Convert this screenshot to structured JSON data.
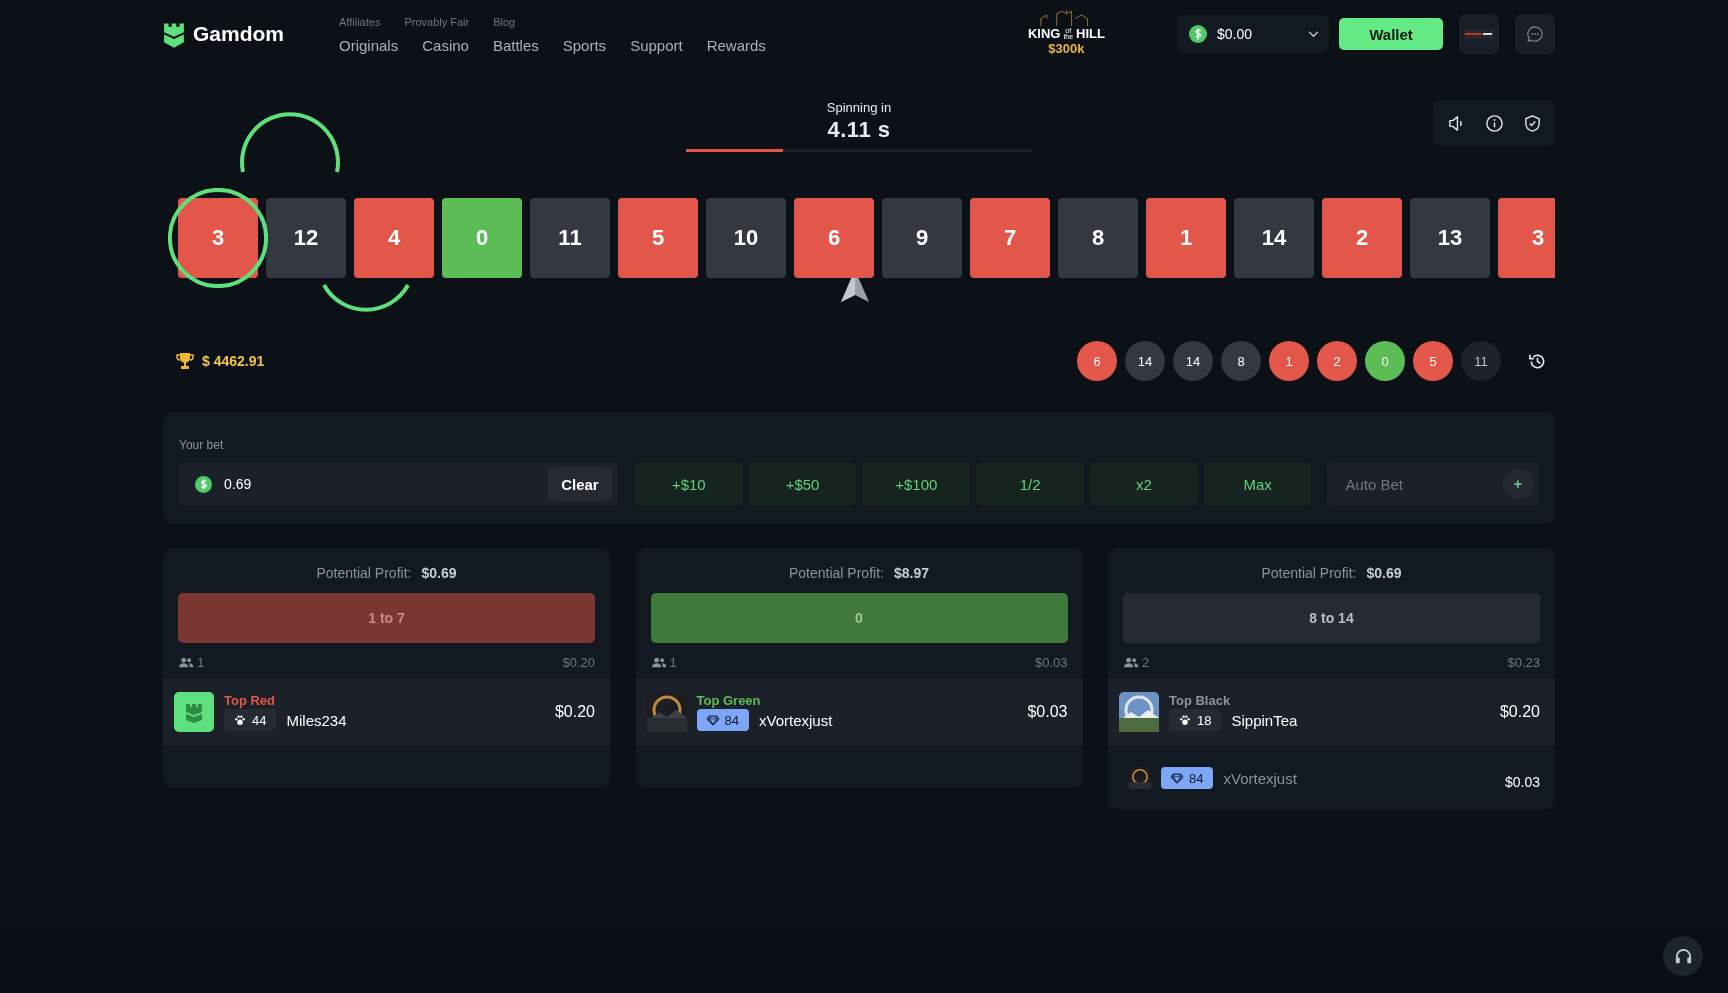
{
  "header": {
    "logo": "Gamdom",
    "top_links": [
      "Affiliates",
      "Provably Fair",
      "Blog"
    ],
    "nav": [
      "Originals",
      "Casino",
      "Battles",
      "Sports",
      "Support",
      "Rewards"
    ],
    "promo": {
      "word1": "KING",
      "small_top": "of",
      "small_bottom": "the",
      "word2": "HILL",
      "prize": "$300k"
    },
    "balance": "$0.00",
    "wallet_button": "Wallet"
  },
  "countdown": {
    "label": "Spinning in",
    "time": "4.11 s",
    "level": 0.28
  },
  "tiles": [
    {
      "number": "3",
      "kind": "red"
    },
    {
      "number": "12",
      "kind": "black"
    },
    {
      "number": "4",
      "kind": "red"
    },
    {
      "number": "0",
      "kind": "green"
    },
    {
      "number": "11",
      "kind": "black"
    },
    {
      "number": "5",
      "kind": "red"
    },
    {
      "number": "10",
      "kind": "black"
    },
    {
      "number": "6",
      "kind": "red"
    },
    {
      "number": "9",
      "kind": "black"
    },
    {
      "number": "7",
      "kind": "red"
    },
    {
      "number": "8",
      "kind": "black"
    },
    {
      "number": "1",
      "kind": "red"
    },
    {
      "number": "14",
      "kind": "black"
    },
    {
      "number": "2",
      "kind": "red"
    },
    {
      "number": "13",
      "kind": "black"
    },
    {
      "number": "3",
      "kind": "red"
    }
  ],
  "jackpot": "$ 4462.91",
  "history": [
    {
      "number": "6",
      "kind": "red",
      "dimmed": false
    },
    {
      "number": "14",
      "kind": "black",
      "dimmed": false
    },
    {
      "number": "14",
      "kind": "black",
      "dimmed": false
    },
    {
      "number": "8",
      "kind": "black",
      "dimmed": false
    },
    {
      "number": "1",
      "kind": "red",
      "dimmed": false
    },
    {
      "number": "2",
      "kind": "red",
      "dimmed": false
    },
    {
      "number": "0",
      "kind": "green",
      "dimmed": false
    },
    {
      "number": "5",
      "kind": "red",
      "dimmed": false
    },
    {
      "number": "11",
      "kind": "black",
      "dimmed": true
    }
  ],
  "bet": {
    "label": "Your bet",
    "value": "0.69",
    "clear_button": "Clear",
    "quick_buttons": [
      "+$10",
      "+$50",
      "+$100",
      "1/2",
      "x2",
      "Max"
    ],
    "auto_bet": {
      "placeholder": "Auto Bet",
      "button": "+"
    }
  },
  "columns": [
    {
      "kind": "red",
      "profit_label": "Potential Profit:",
      "profit": "$0.69",
      "button": "1 to 7",
      "players": "1",
      "total": "$0.20",
      "top": {
        "title": "Top Red",
        "avatar": {
          "kind": "logo"
        },
        "badge": {
          "kind": "paw",
          "rank": "44"
        },
        "name": "Miles234",
        "amount": "$0.20"
      }
    },
    {
      "kind": "green",
      "profit_label": "Potential Profit:",
      "profit": "$8.97",
      "button": "0",
      "players": "1",
      "total": "$0.03",
      "top": {
        "title": "Top Green",
        "badge": {
          "kind": "diamond",
          "rank": "84"
        },
        "name": "xVortexjust",
        "amount": "$0.03"
      }
    },
    {
      "kind": "black",
      "profit_label": "Potential Profit:",
      "profit": "$0.69",
      "button": "8 to 14",
      "players": "2",
      "total": "$0.23",
      "top": {
        "title": "Top Black",
        "badge": {
          "kind": "paw",
          "rank": "18"
        },
        "name": "SippinTea",
        "amount": "$0.20"
      },
      "others": [
        {
          "badge": {
            "kind": "diamond",
            "rank": "84"
          },
          "name": "xVortexjust",
          "amount": "$0.03"
        }
      ]
    }
  ]
}
